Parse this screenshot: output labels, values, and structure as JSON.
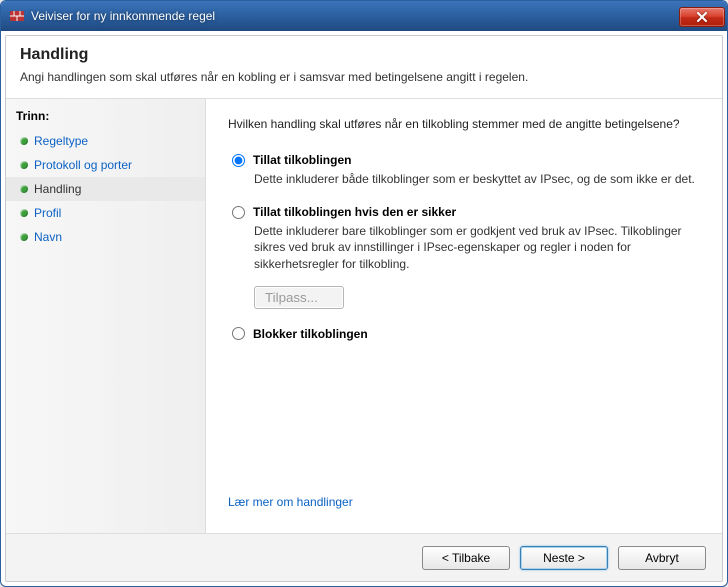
{
  "window": {
    "title": "Veiviser for ny innkommende regel"
  },
  "header": {
    "title": "Handling",
    "subtitle": "Angi handlingen som skal utføres når en kobling er i samsvar med betingelsene angitt i regelen."
  },
  "sidebar": {
    "heading": "Trinn:",
    "items": [
      {
        "label": "Regeltype",
        "current": false
      },
      {
        "label": "Protokoll og porter",
        "current": false
      },
      {
        "label": "Handling",
        "current": true
      },
      {
        "label": "Profil",
        "current": false
      },
      {
        "label": "Navn",
        "current": false
      }
    ]
  },
  "main": {
    "question": "Hvilken handling skal utføres når en tilkobling stemmer med de angitte betingelsene?",
    "options": [
      {
        "label": "Tillat tilkoblingen",
        "desc": "Dette inkluderer både tilkoblinger som er beskyttet av IPsec, og de som ikke er det.",
        "selected": true
      },
      {
        "label": "Tillat tilkoblingen hvis den er sikker",
        "desc": "Dette inkluderer bare tilkoblinger som er godkjent ved bruk av IPsec. Tilkoblinger sikres ved bruk av innstillinger i IPsec-egenskaper og regler i noden for sikkerhetsregler for tilkobling.",
        "selected": false
      },
      {
        "label": "Blokker tilkoblingen",
        "desc": "",
        "selected": false
      }
    ],
    "customize_label": "Tilpass...",
    "learn_more": "Lær mer om handlinger"
  },
  "footer": {
    "back": "< Tilbake",
    "next": "Neste >",
    "cancel": "Avbryt"
  }
}
